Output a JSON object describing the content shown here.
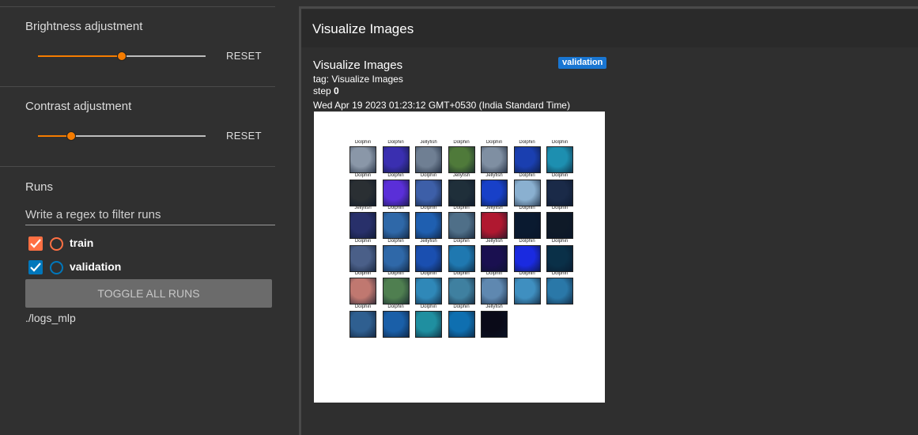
{
  "sidebar": {
    "brightness": {
      "title": "Brightness adjustment",
      "value": 0.5,
      "reset_label": "RESET"
    },
    "contrast": {
      "title": "Contrast adjustment",
      "value": 0.2,
      "reset_label": "RESET"
    },
    "runs": {
      "title": "Runs",
      "filter_placeholder": "Write a regex to filter runs",
      "items": [
        {
          "label": "train",
          "checked": true,
          "color": "#ff7043"
        },
        {
          "label": "validation",
          "checked": true,
          "color": "#0077bb"
        }
      ],
      "toggle_all_label": "TOGGLE ALL RUNS",
      "logdir": "./logs_mlp"
    }
  },
  "main": {
    "group_title": "Visualize Images",
    "card": {
      "title": "Visualize Images",
      "tag_line": "tag: Visualize Images",
      "step_label": "step",
      "step_value": "0",
      "timestamp": "Wed Apr 19 2023 01:23:12 GMT+0530 (India Standard Time)",
      "run_badge": "validation"
    },
    "image_grid": {
      "rows": [
        [
          "Dolphin",
          "Dolphin",
          "Jellyfish",
          "Dolphin",
          "Dolphin",
          "Dolphin",
          "Dolphin"
        ],
        [
          "Dolphin",
          "Dolphin",
          "Dolphin",
          "Jellyfish",
          "Jellyfish",
          "Dolphin",
          "Dolphin"
        ],
        [
          "Jellyfish",
          "Dolphin",
          "Dolphin",
          "Dolphin",
          "Jellyfish",
          "Dolphin",
          "Dolphin"
        ],
        [
          "Dolphin",
          "Dolphin",
          "Jellyfish",
          "Dolphin",
          "Jellyfish",
          "Dolphin",
          "Dolphin"
        ],
        [
          "Dolphin",
          "Dolphin",
          "Dolphin",
          "Dolphin",
          "Dolphin",
          "Dolphin",
          "Dolphin"
        ],
        [
          "Dolphin",
          "Dolphin",
          "Dolphin",
          "Dolphin",
          "Jellyfish"
        ]
      ],
      "tile_colors": [
        [
          "#8a97a8",
          "#3a2fb0",
          "#6f7f93",
          "#4f7a3a",
          "#7f8fa2",
          "#1a3fb0",
          "#1d8fb0"
        ],
        [
          "#2a2f33",
          "#5a2fd8",
          "#3d5fa8",
          "#1f2f3a",
          "#1840c8",
          "#8ab0d0",
          "#1a2a48"
        ],
        [
          "#28306a",
          "#2f68a8",
          "#1f5fb0",
          "#4f6f88",
          "#b01830",
          "#0a1a30",
          "#0f1a28"
        ],
        [
          "#4a5f88",
          "#2f68a8",
          "#1a4fb0",
          "#1f78b0",
          "#1a1050",
          "#1a2ae0",
          "#0a3048"
        ],
        [
          "#c07870",
          "#4f7f50",
          "#2f88b8",
          "#3f80a0",
          "#5f88b0",
          "#3f8fc0",
          "#2a78a8"
        ],
        [
          "#2f5f90",
          "#1a5fa8",
          "#1f8fa0",
          "#0f6fb0",
          "#0a0a18"
        ]
      ]
    }
  }
}
